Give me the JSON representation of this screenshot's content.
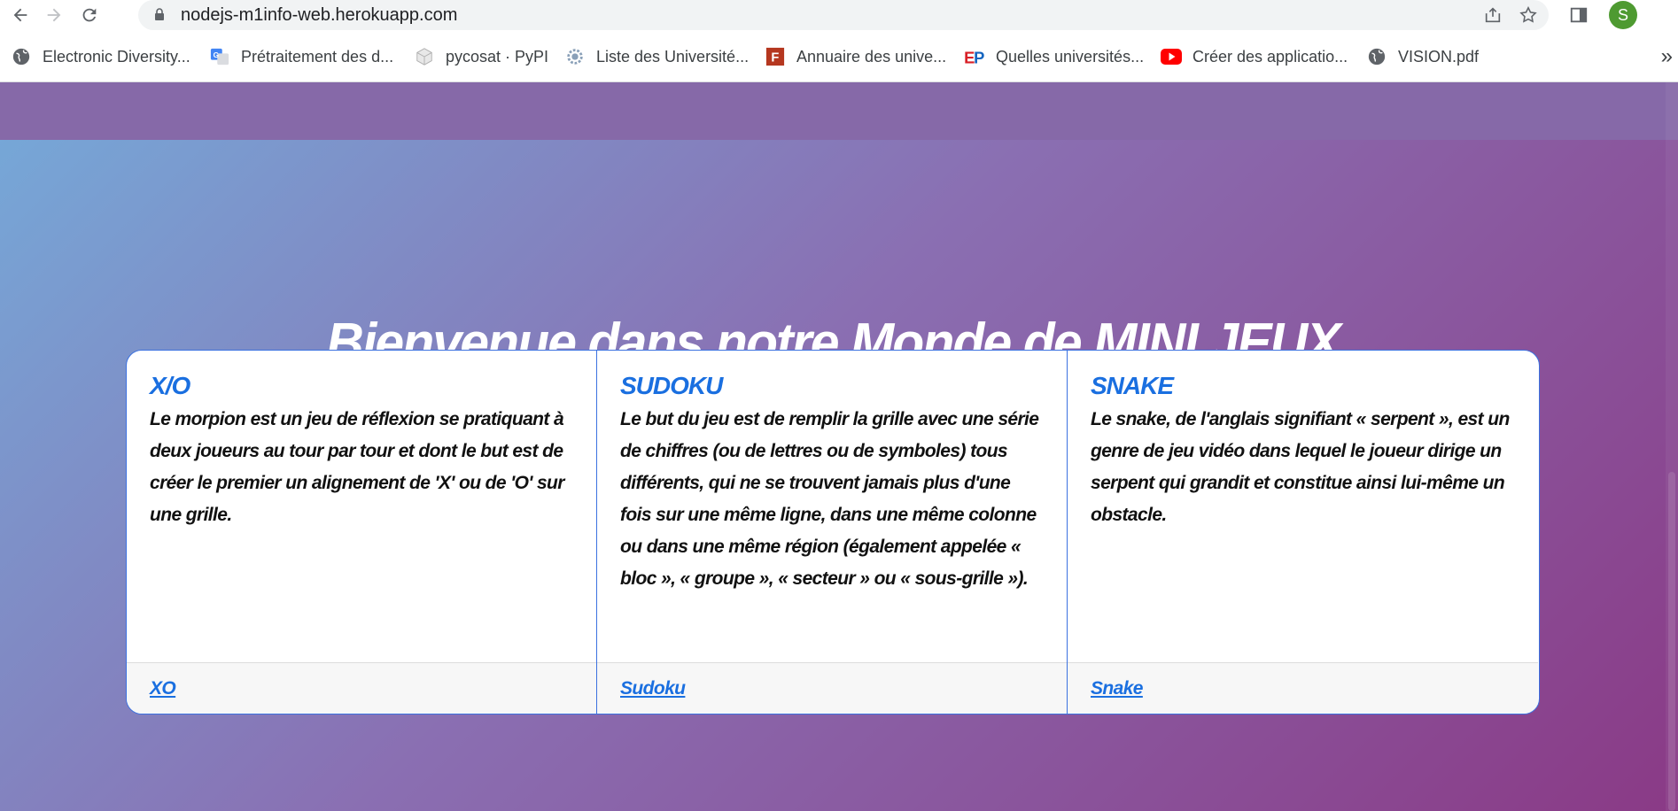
{
  "browser": {
    "url": "nodejs-m1info-web.herokuapp.com",
    "avatar_letter": "S",
    "bookmarks": [
      {
        "label": "Electronic Diversity...",
        "icon": "globe-icon"
      },
      {
        "label": "Prétraitement des d...",
        "icon": "google-translate-icon"
      },
      {
        "label": "pycosat · PyPI",
        "icon": "pypi-icon"
      },
      {
        "label": "Liste des Université...",
        "icon": "gear-logo-icon"
      },
      {
        "label": "Annuaire des unive...",
        "icon": "f-logo-icon"
      },
      {
        "label": "Quelles universités...",
        "icon": "ep-logo-icon"
      },
      {
        "label": "Créer des applicatio...",
        "icon": "youtube-icon"
      },
      {
        "label": "VISION.pdf",
        "icon": "globe-icon"
      }
    ],
    "more_label": "»"
  },
  "page": {
    "title": "Bienvenue dans notre Monde de MINI JEUX",
    "cards": [
      {
        "title": "X/O",
        "text": "Le morpion est un jeu de réflexion se pratiquant à deux joueurs au tour par tour et dont le but est de créer le premier un alignement de 'X' ou de 'O' sur une grille.",
        "link": "XO"
      },
      {
        "title": "SUDOKU",
        "text": "Le but du jeu est de remplir la grille avec une série de chiffres (ou de lettres ou de symboles) tous différents, qui ne se trouvent jamais plus d'une fois sur une même ligne, dans une même colonne ou dans une même région (également appelée « bloc », « groupe », « secteur » ou « sous-grille »).",
        "link": "Sudoku"
      },
      {
        "title": "SNAKE",
        "text": "Le snake, de l'anglais signifiant « serpent », est un genre de jeu vidéo dans lequel le joueur dirige un serpent qui grandit et constitue ainsi lui-même un obstacle.",
        "link": "Snake"
      }
    ]
  },
  "colors": {
    "accent": "#1a6fe0",
    "avatar": "#4e9a31"
  }
}
